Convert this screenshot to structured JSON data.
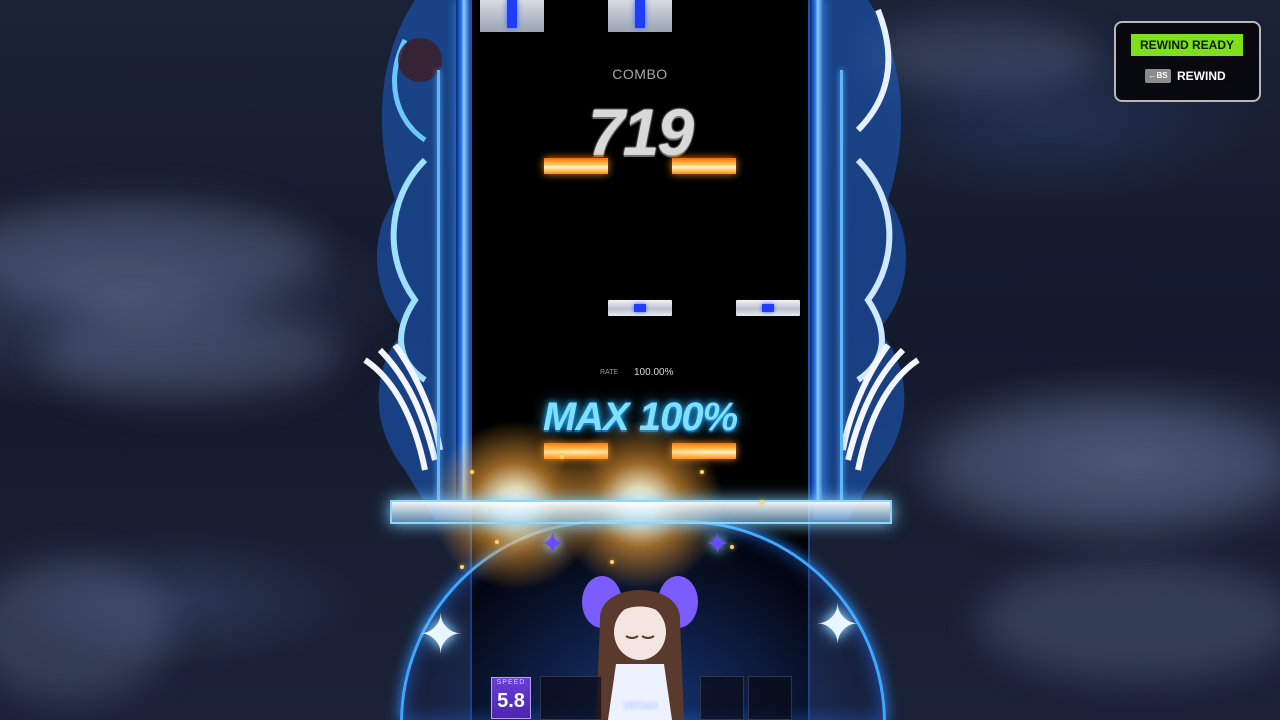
{
  "hud": {
    "combo_label": "COMBO",
    "combo_value": "719",
    "rate_label": "RATE",
    "rate_value": "100.00%",
    "max_label": "MAX 100%"
  },
  "speed": {
    "label": "SPEED",
    "value": "5.8"
  },
  "score": {
    "value": "197543"
  },
  "rewind": {
    "status_label": "REWIND READY",
    "key_label": "←BS",
    "action_label": "REWIND"
  },
  "colors": {
    "note_blue": "#1f3cff",
    "note_orange": "#ff8a00",
    "max_text": "#7fe0ff",
    "rewind_ready_bg": "#7ee01b",
    "frame_accent": "#3fa7ff"
  }
}
